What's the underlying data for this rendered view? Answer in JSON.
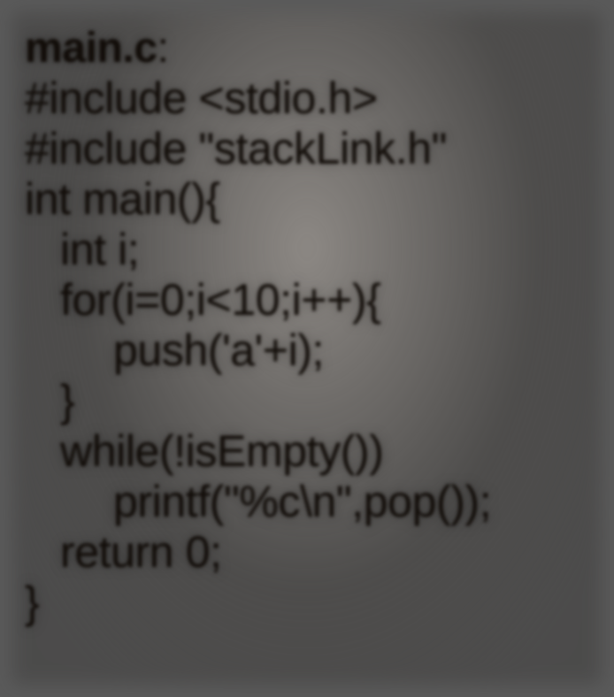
{
  "code": {
    "filename": "main.c",
    "colon": ":",
    "lines": [
      "#include <stdio.h>",
      "#include \"stackLink.h\"",
      "int main(){",
      "int i;",
      "for(i=0;i<10;i++){",
      "push('a'+i);",
      "}",
      "while(!isEmpty())",
      "printf(\"%c\\n\",pop());",
      "return 0;",
      "}"
    ]
  }
}
